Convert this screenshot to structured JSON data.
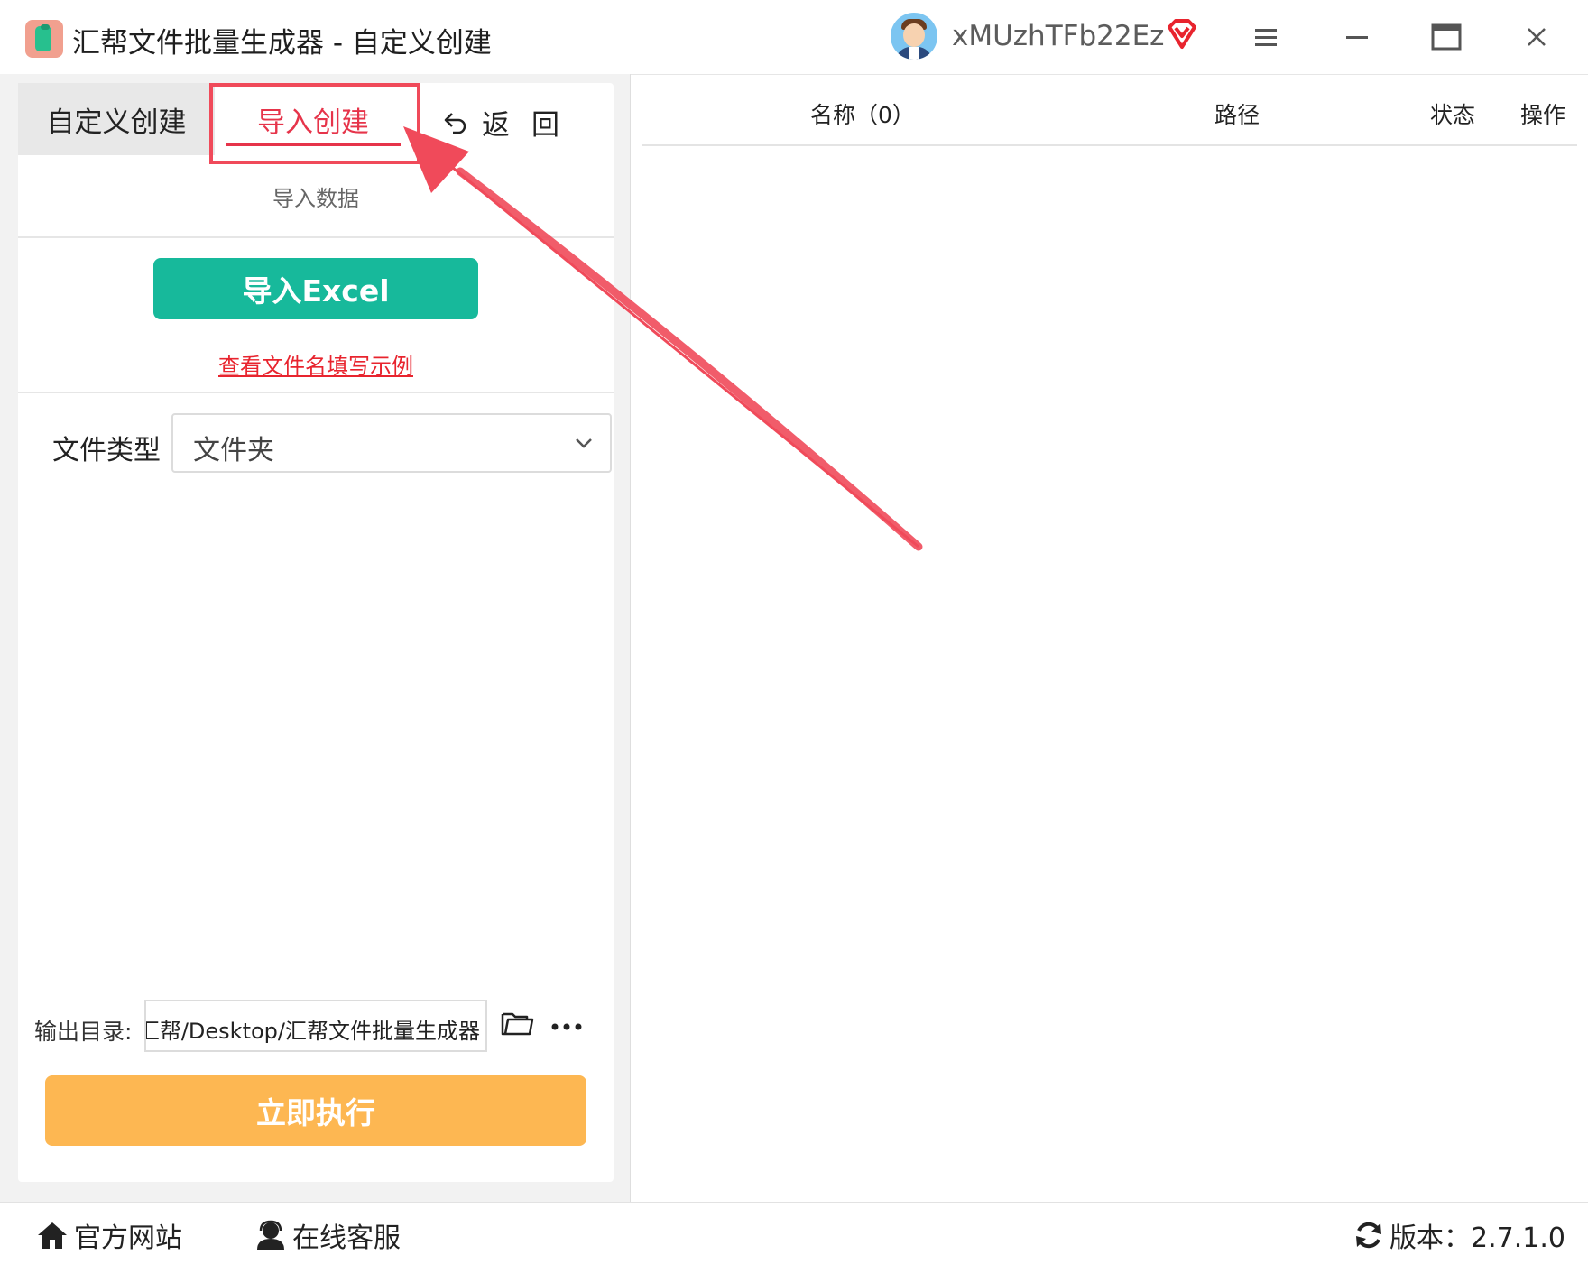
{
  "window": {
    "title": "汇帮文件批量生成器 - 自定义创建",
    "username": "xMUzhTFb22Ez"
  },
  "tabs": {
    "custom_label": "自定义创建",
    "import_label": "导入创建",
    "back_label": "返回"
  },
  "import_section": {
    "heading": "导入数据",
    "excel_button": "导入Excel",
    "example_link": "查看文件名填写示例"
  },
  "file_type": {
    "label": "文件类型",
    "selected": "文件夹"
  },
  "output": {
    "label": "输出目录:",
    "path": "汇帮/Desktop/汇帮文件批量生成器"
  },
  "run_button": "立即执行",
  "table": {
    "columns": [
      "名称（0）",
      "路径",
      "状态",
      "操作"
    ]
  },
  "statusbar": {
    "website": "官方网站",
    "support": "在线客服",
    "version": "版本：2.7.1.0"
  },
  "colors": {
    "accent_red": "#e6344a",
    "excel_green": "#17b99b",
    "run_orange": "#fdb752",
    "annotation_red": "#f04a5a"
  },
  "icons": {
    "app": "app-logo-icon",
    "vip": "vip-diamond-icon",
    "menu": "menu-icon",
    "minimize": "minimize-icon",
    "maximize": "maximize-icon",
    "close": "close-icon",
    "back": "back-arrow-icon",
    "chevron": "chevron-down-icon",
    "folder": "folder-icon",
    "more": "more-icon",
    "home": "home-icon",
    "support": "support-icon",
    "refresh": "refresh-icon"
  }
}
